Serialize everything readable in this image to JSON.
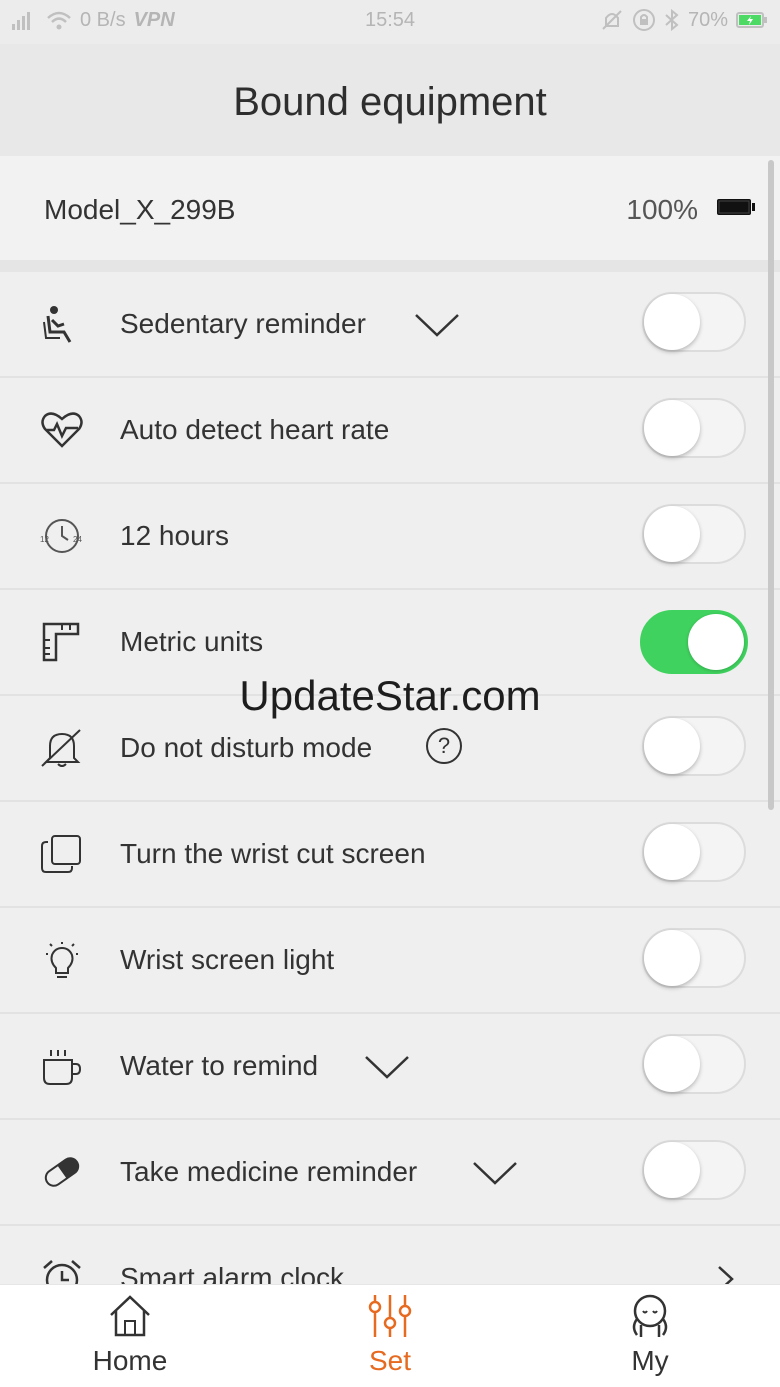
{
  "status_bar": {
    "network_speed": "0 B/s",
    "vpn": "VPN",
    "time": "15:54",
    "battery": "70%"
  },
  "header": {
    "title": "Bound equipment"
  },
  "device": {
    "name": "Model_X_299B",
    "battery_text": "100%"
  },
  "settings": [
    {
      "label": "Sedentary reminder",
      "icon": "sedentary-icon",
      "expandable": true,
      "on": false
    },
    {
      "label": "Auto detect heart rate",
      "icon": "heart-rate-icon",
      "expandable": false,
      "on": false
    },
    {
      "label": "12 hours",
      "icon": "clock-12-24-icon",
      "expandable": false,
      "on": false
    },
    {
      "label": "Metric units",
      "icon": "ruler-icon",
      "expandable": false,
      "on": true
    },
    {
      "label": "Do not disturb mode",
      "icon": "bell-off-icon",
      "help": "?",
      "on": false
    },
    {
      "label": "Turn the wrist cut screen",
      "icon": "screens-icon",
      "expandable": false,
      "on": false
    },
    {
      "label": "Wrist screen light",
      "icon": "bulb-icon",
      "expandable": false,
      "on": false
    },
    {
      "label": "Water to remind",
      "icon": "cup-icon",
      "expandable": true,
      "on": false
    },
    {
      "label": "Take medicine reminder",
      "icon": "pill-icon",
      "expandable": true,
      "on": false
    },
    {
      "label": "Smart alarm clock",
      "icon": "alarm-clock-icon",
      "arrow": true
    }
  ],
  "watermark": "UpdateStar.com",
  "tabs": [
    {
      "label": "Home",
      "icon": "home-icon",
      "active": false
    },
    {
      "label": "Set",
      "icon": "sliders-icon",
      "active": true
    },
    {
      "label": "My",
      "icon": "profile-icon",
      "active": false
    }
  ],
  "colors": {
    "accent": "#e66a1f",
    "toggle_on": "#3fd25e"
  }
}
